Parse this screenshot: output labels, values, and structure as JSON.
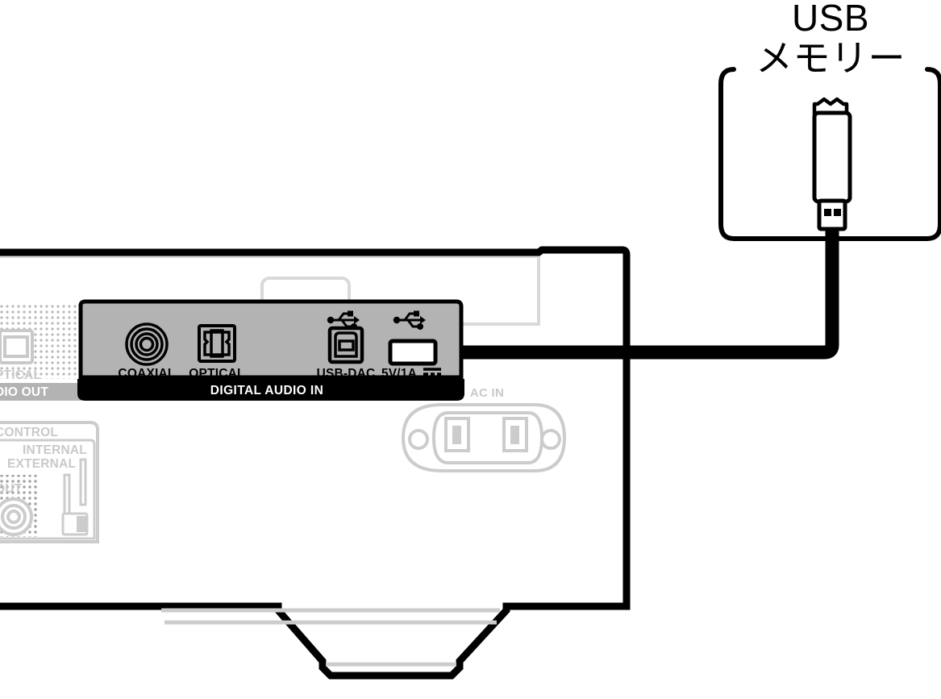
{
  "diagram": {
    "title_line1": "USB",
    "title_line2": "メモリー",
    "device_description": "audio-component-rear-panel"
  },
  "usb_device": {
    "label": "USB メモリー",
    "icon": "usb-flash-drive-icon",
    "cable": "usb-cable"
  },
  "rear_panel": {
    "digital_audio_in": {
      "band_label": "DIGITAL AUDIO IN",
      "ports": [
        {
          "label": "COAXIAL",
          "icon": "coaxial-jack-icon"
        },
        {
          "label": "OPTICAL",
          "icon": "optical-toslink-icon"
        },
        {
          "label": "USB-DAC",
          "icon": "usb-b-port-icon",
          "badge": "usb-trident-icon"
        },
        {
          "label": "5V/1A",
          "icon": "usb-a-port-icon",
          "badge": "usb-trident-icon",
          "suffix": "dc-power-icon"
        }
      ]
    },
    "ac_inlet": {
      "label": "AC IN",
      "icon": "ac-power-inlet-icon"
    },
    "audio_out_panel": {
      "optical_label": "PTICAL",
      "band_label": "DIO OUT",
      "icon": "optical-toslink-icon"
    },
    "control_panel": {
      "title": "CONTROL",
      "internal_label": "INTERNAL",
      "external_label": "EXTERNAL",
      "out_label": "OUT",
      "switch": "internal-external-slide-switch",
      "jack": "rca-jack-icon"
    }
  },
  "colors": {
    "outline": "#000000",
    "panel_face": "#b3b3b3",
    "band": "#000000",
    "ghost": "#c9c9c9",
    "ghost_light": "#d9d9d9",
    "white": "#ffffff"
  }
}
